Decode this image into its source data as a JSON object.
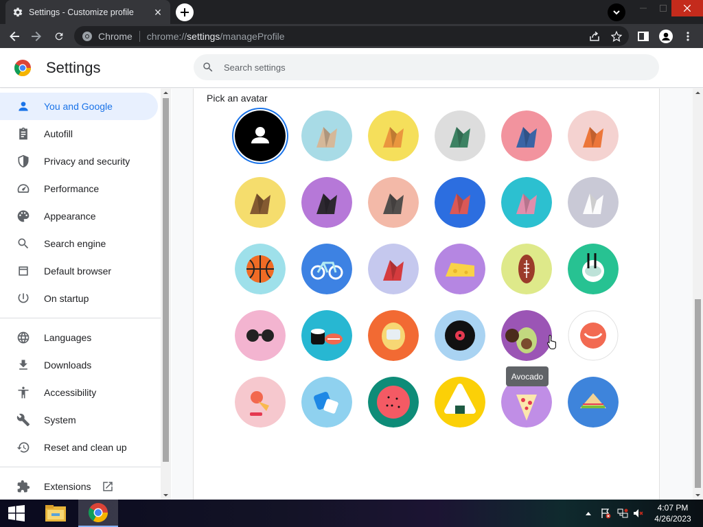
{
  "browser": {
    "tab_title": "Settings - Customize profile",
    "site_label": "Chrome",
    "url_prefix": "chrome://",
    "url_host": "settings",
    "url_path": "/manageProfile"
  },
  "header": {
    "title": "Settings",
    "search_placeholder": "Search settings"
  },
  "sidebar": {
    "items": [
      {
        "label": "You and Google",
        "icon": "person-icon",
        "active": true
      },
      {
        "label": "Autofill",
        "icon": "clipboard-icon"
      },
      {
        "label": "Privacy and security",
        "icon": "shield-icon"
      },
      {
        "label": "Performance",
        "icon": "speedometer-icon"
      },
      {
        "label": "Appearance",
        "icon": "palette-icon"
      },
      {
        "label": "Search engine",
        "icon": "search-icon"
      },
      {
        "label": "Default browser",
        "icon": "browser-window-icon"
      },
      {
        "label": "On startup",
        "icon": "power-icon"
      },
      {
        "label": "Languages",
        "icon": "globe-icon"
      },
      {
        "label": "Downloads",
        "icon": "download-icon"
      },
      {
        "label": "Accessibility",
        "icon": "accessibility-icon"
      },
      {
        "label": "System",
        "icon": "wrench-icon"
      },
      {
        "label": "Reset and clean up",
        "icon": "history-icon"
      }
    ],
    "extensions_label": "Extensions"
  },
  "main": {
    "pick_avatar_label": "Pick an avatar",
    "tooltip": "Avocado",
    "avatars": [
      {
        "name": "generic-person",
        "bg": "#000000",
        "selected": true
      },
      {
        "name": "cat",
        "bg": "#a8dbe6"
      },
      {
        "name": "corgi",
        "bg": "#f5df5b"
      },
      {
        "name": "dragon",
        "bg": "#dddddd"
      },
      {
        "name": "elephant",
        "bg": "#f2939e"
      },
      {
        "name": "fox",
        "bg": "#f4d2d0"
      },
      {
        "name": "monkey",
        "bg": "#f5dd6d"
      },
      {
        "name": "panda",
        "bg": "#b678d8"
      },
      {
        "name": "penguin",
        "bg": "#f3b9a8"
      },
      {
        "name": "butterfly",
        "bg": "#2c6ee0"
      },
      {
        "name": "rabbit",
        "bg": "#2cc0d0"
      },
      {
        "name": "unicorn",
        "bg": "#c9c9d6"
      },
      {
        "name": "basketball",
        "bg": "#9ee0ea"
      },
      {
        "name": "bicycle",
        "bg": "#3d82e3"
      },
      {
        "name": "bird",
        "bg": "#c5c8ee"
      },
      {
        "name": "cheese",
        "bg": "#b586e2"
      },
      {
        "name": "football",
        "bg": "#dee98a"
      },
      {
        "name": "ramen",
        "bg": "#27c292"
      },
      {
        "name": "sunglasses",
        "bg": "#f3b4d0"
      },
      {
        "name": "sushi",
        "bg": "#27b7d2"
      },
      {
        "name": "tamagotchi",
        "bg": "#f26a33"
      },
      {
        "name": "vinyl",
        "bg": "#a9d3f2"
      },
      {
        "name": "avocado",
        "bg": "#9b55b5"
      },
      {
        "name": "onigiri-smile",
        "bg": "#ffffff"
      },
      {
        "name": "ice-cream",
        "bg": "#f6c8ce"
      },
      {
        "name": "ice-cubes",
        "bg": "#8fd1ef"
      },
      {
        "name": "watermelon",
        "bg": "#0e8c78"
      },
      {
        "name": "onigiri",
        "bg": "#fbd007"
      },
      {
        "name": "pizza",
        "bg": "#c08ee6"
      },
      {
        "name": "sandwich",
        "bg": "#3e84db"
      }
    ]
  },
  "taskbar": {
    "time": "4:07 PM",
    "date": "4/26/2023"
  },
  "colors": {
    "accent": "#1a73e8",
    "active_nav_bg": "#e8f0fe",
    "chrome_dark": "#202124",
    "toolbar": "#35363a"
  }
}
